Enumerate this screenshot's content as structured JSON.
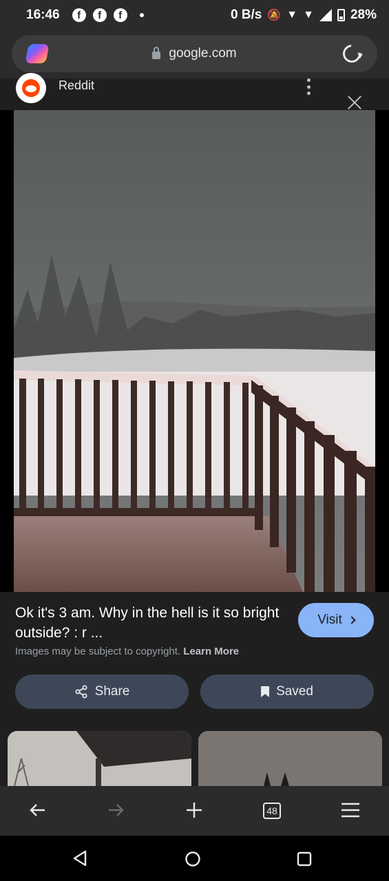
{
  "status_bar": {
    "time": "16:46",
    "notification_icons": [
      "facebook-icon",
      "facebook-icon",
      "facebook-icon"
    ],
    "net_speed": "0 B/s",
    "battery": "28%"
  },
  "browser": {
    "url": "google.com"
  },
  "source": {
    "name": "Reddit"
  },
  "result": {
    "title": "Ok it's 3 am. Why in the hell is it so bright outside? : r ...",
    "visit_label": "Visit",
    "copyright_text": "Images may be subject to copyright.",
    "learn_more": "Learn More",
    "share_label": "Share",
    "saved_label": "Saved"
  },
  "toolbar": {
    "tab_count": "48"
  },
  "colors": {
    "accent": "#8ab4f8",
    "chip_bg": "#3d4758",
    "background": "#1f1f1f"
  }
}
